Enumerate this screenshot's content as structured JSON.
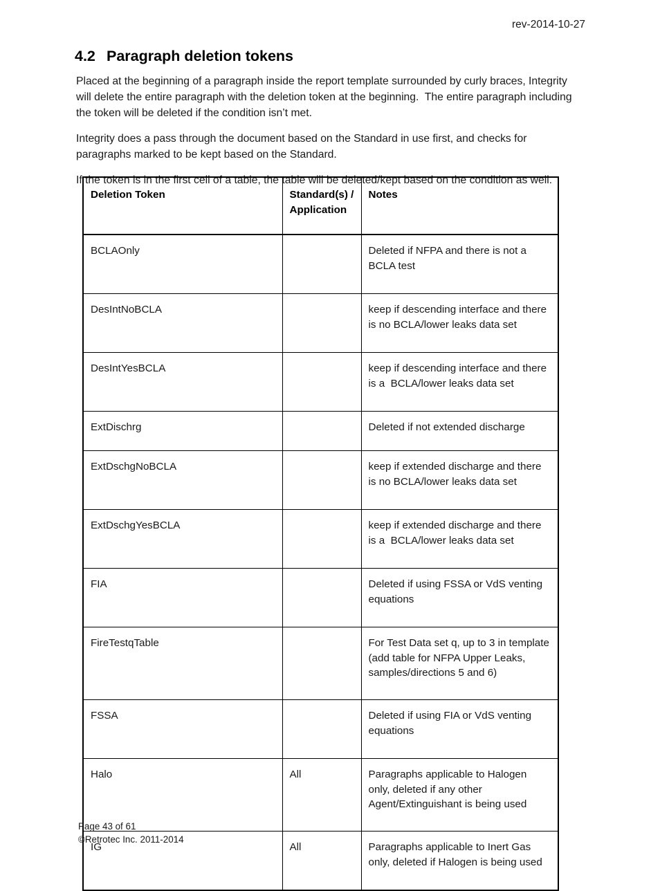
{
  "header": {
    "revision": "rev-2014-10-27"
  },
  "heading": {
    "number": "4.2",
    "title": "Paragraph deletion tokens"
  },
  "paragraphs": [
    "Placed at the beginning of a paragraph inside the report template surrounded by curly braces, Integrity will delete the entire paragraph with the deletion token at the beginning.  The entire paragraph including the token will be deleted if the condition isn’t met.",
    "Integrity does a pass through the document based on the Standard in use first, and checks for paragraphs marked to be kept based on the Standard.",
    "If the token is in the first cell of a table, the table will be deleted/kept based on the condition as well."
  ],
  "table": {
    "columns": [
      "Deletion Token",
      "Standard(s) / Application",
      "Notes"
    ],
    "column_headers": {
      "token": "Deletion Token",
      "standard": "Standard(s) /\nApplication",
      "notes": "Notes"
    },
    "rows": [
      {
        "token": "BCLAOnly",
        "standard": "",
        "notes": "Deleted if NFPA and there is not a BCLA test"
      },
      {
        "token": "DesIntNoBCLA",
        "standard": "",
        "notes": "keep if descending interface and there is no BCLA/lower leaks data set"
      },
      {
        "token": "DesIntYesBCLA",
        "standard": "",
        "notes": "keep if descending interface and there is a  BCLA/lower leaks data set"
      },
      {
        "token": "ExtDischrg",
        "standard": "",
        "notes": "Deleted if not extended discharge"
      },
      {
        "token": "ExtDschgNoBCLA",
        "standard": "",
        "notes": "keep if extended discharge and there is no BCLA/lower leaks data set"
      },
      {
        "token": "ExtDschgYesBCLA",
        "standard": "",
        "notes": "keep if extended discharge and there is a  BCLA/lower leaks data set"
      },
      {
        "token": "FIA",
        "standard": "",
        "notes": "Deleted if using FSSA or VdS venting equations"
      },
      {
        "token": "FireTestqTable",
        "standard": "",
        "notes": "For Test Data set q, up to 3 in template (add table for NFPA Upper Leaks, samples/directions 5 and 6)"
      },
      {
        "token": "FSSA",
        "standard": "",
        "notes": "Deleted if using FIA or VdS venting equations"
      },
      {
        "token": "Halo",
        "standard": "All",
        "notes": "Paragraphs applicable to Halogen only, deleted if any other Agent/Extinguishant is being used"
      },
      {
        "token": "IG",
        "standard": "All",
        "notes": "Paragraphs applicable to Inert Gas only, deleted if Halogen is being used"
      }
    ]
  },
  "footer": {
    "page": "Page 43 of 61",
    "copyright": "©Retrotec Inc. 2011-2014"
  }
}
